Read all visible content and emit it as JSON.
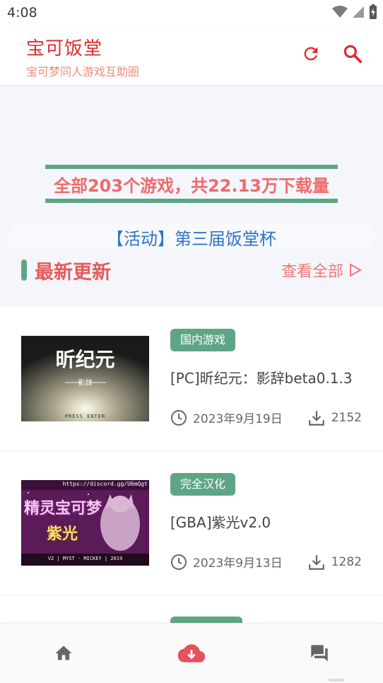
{
  "status_bar": {
    "time": "4:08"
  },
  "app_bar": {
    "title": "宝可饭堂",
    "subtitle": "宝可梦同人游戏互助圈",
    "icons": [
      "refresh-icon",
      "search-icon"
    ]
  },
  "banner": {
    "stats_text": "全部203个游戏，共22.13万下载量",
    "activity_text": "【活动】第三届饭堂杯"
  },
  "section": {
    "title": "最新更新",
    "see_all": "查看全部"
  },
  "games": [
    {
      "tag": "国内游戏",
      "name": "[PC]昕纪元：影辞beta0.1.3",
      "date": "2023年9月19日",
      "downloads": "2152",
      "thumb": {
        "title": "昕纪元",
        "subtitle": "影辞",
        "caption": "PRESS ENTER"
      }
    },
    {
      "tag": "完全汉化",
      "name": "[GBA]紫光v2.0",
      "date": "2023年9月13日",
      "downloads": "1282",
      "thumb": {
        "url_text": "https://discord.gg/U6mQgt",
        "logo": "精灵宝可梦",
        "subtitle": "紫光",
        "footer": "V2 | MYST · MICKEY | 2019"
      }
    }
  ],
  "bottom_nav": {
    "items": [
      "home-icon",
      "cloud-download-icon",
      "forum-icon"
    ],
    "active": "cloud-download-icon"
  },
  "colors": {
    "brand_red": "#e02b2b",
    "accent_green": "#5ea586",
    "link_blue": "#2e73c9",
    "pink": "#f06a6a"
  }
}
